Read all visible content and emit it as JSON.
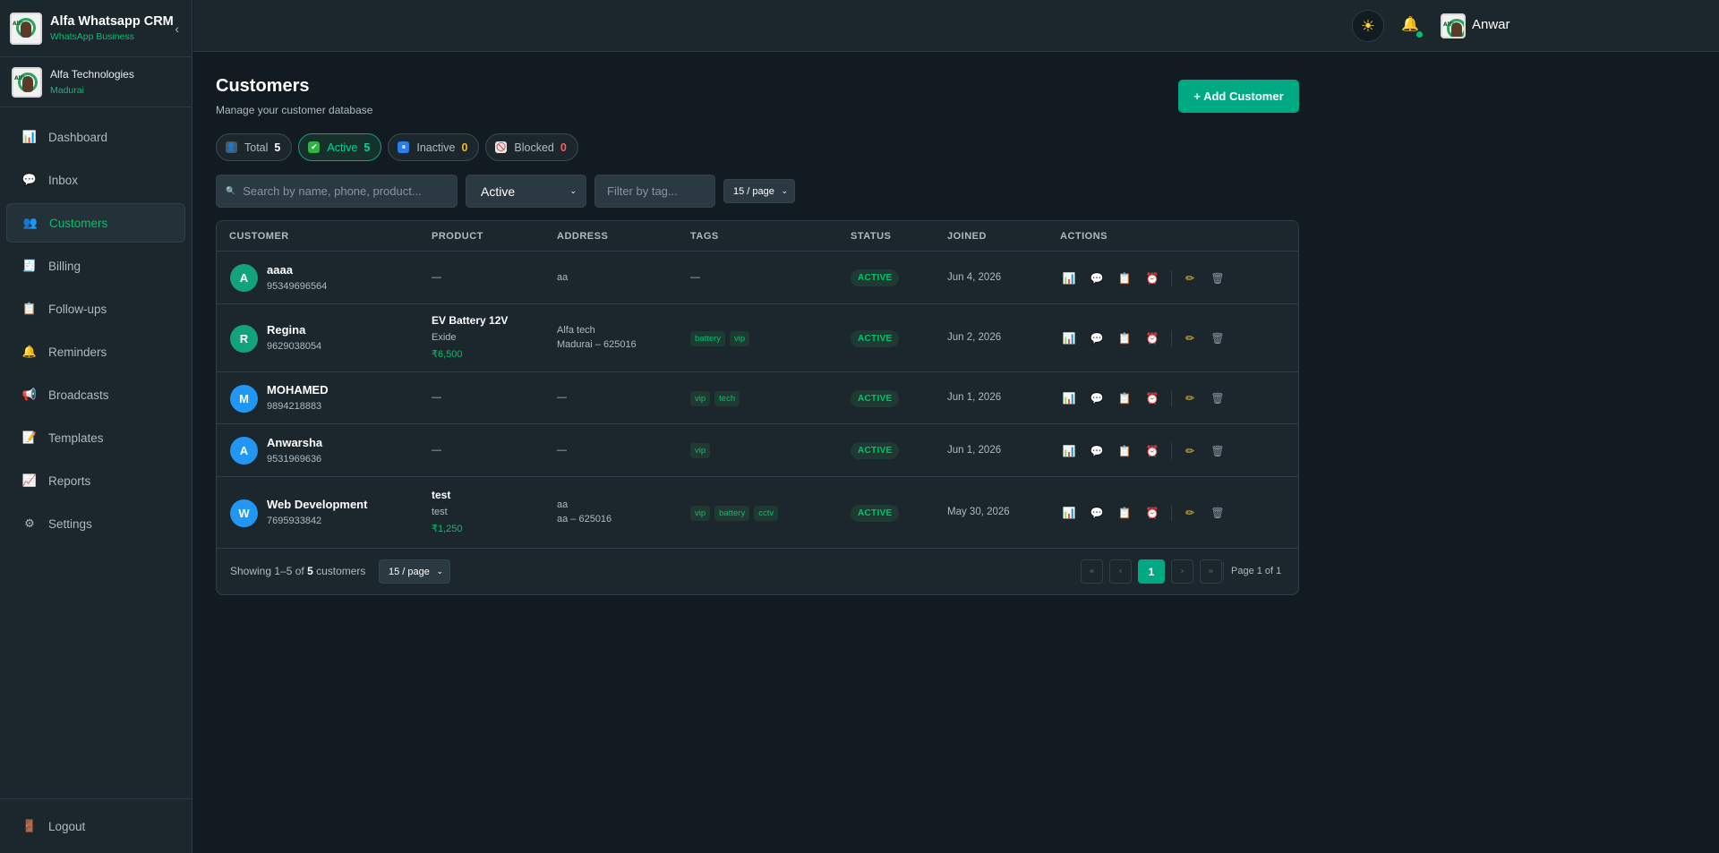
{
  "app": {
    "title": "Alfa Whatsapp CRM",
    "subtitle": "WhatsApp Business",
    "collapse_icon": "chevron-left-icon",
    "collapse_glyph": "‹"
  },
  "org": {
    "name": "Alfa Technologies",
    "location": "Madurai"
  },
  "sidebar": {
    "items": [
      {
        "label": "Dashboard",
        "icon": "bar-chart-icon",
        "glyph": "📊",
        "active": false
      },
      {
        "label": "Inbox",
        "icon": "chat-icon",
        "glyph": "💬",
        "active": false
      },
      {
        "label": "Customers",
        "icon": "users-icon",
        "glyph": "👥",
        "active": true
      },
      {
        "label": "Billing",
        "icon": "receipt-icon",
        "glyph": "🧾",
        "active": false
      },
      {
        "label": "Follow-ups",
        "icon": "clipboard-icon",
        "glyph": "📋",
        "active": false
      },
      {
        "label": "Reminders",
        "icon": "bell-icon",
        "glyph": "🔔",
        "active": false
      },
      {
        "label": "Broadcasts",
        "icon": "megaphone-icon",
        "glyph": "📢",
        "active": false
      },
      {
        "label": "Templates",
        "icon": "memo-icon",
        "glyph": "📝",
        "active": false
      },
      {
        "label": "Reports",
        "icon": "trend-chart-icon",
        "glyph": "📈",
        "active": false
      },
      {
        "label": "Settings",
        "icon": "gear-icon",
        "glyph": "⚙",
        "active": false
      }
    ],
    "logout": {
      "label": "Logout",
      "icon": "door-icon",
      "glyph": "🚪"
    }
  },
  "header": {
    "theme_icon": "sun-icon",
    "theme_glyph": "☀",
    "bell_icon": "bell-icon",
    "bell_glyph": "🔔",
    "user_name": "Anwar"
  },
  "page": {
    "title": "Customers",
    "subtitle": "Manage your customer database",
    "add_button": "+ Add Customer"
  },
  "stats": [
    {
      "label": "Total",
      "count": "5",
      "icon": "user-icon",
      "glyph": "👤",
      "count_color": "#ffffff",
      "icon_bg": "#4a5a63"
    },
    {
      "label": "Active",
      "count": "5",
      "icon": "check-icon",
      "glyph": "✔",
      "count_color": "#00d68f",
      "icon_bg": "#2fb344"
    },
    {
      "label": "Inactive",
      "count": "0",
      "icon": "pause-icon",
      "glyph": "⏸",
      "count_color": "#f5b92a",
      "icon_bg": "#2b7de9"
    },
    {
      "label": "Blocked",
      "count": "0",
      "icon": "block-icon",
      "glyph": "🚫",
      "count_color": "#ff5c5c",
      "icon_bg": "#e8e8e8"
    }
  ],
  "filters": {
    "search_placeholder": "Search by name, phone, product...",
    "search_icon": "search-icon",
    "search_glyph": "🔍",
    "status_value": "Active",
    "tag_placeholder": "Filter by tag...",
    "per_page": "15 / page",
    "chevron_glyph": "⌄"
  },
  "table": {
    "headers": [
      "CUSTOMER",
      "PRODUCT",
      "ADDRESS",
      "TAGS",
      "STATUS",
      "JOINED",
      "ACTIONS"
    ],
    "rows": [
      {
        "initial": "A",
        "avatar_color": "#12a37c",
        "name": "aaaa",
        "phone": "95349696564",
        "product_name": "",
        "product_brand": "",
        "product_price": "",
        "product_dash": "—",
        "address1": "aa",
        "address2": "",
        "tags": [],
        "tags_dash": "—",
        "status": "ACTIVE",
        "joined": "Jun 4, 2026"
      },
      {
        "initial": "R",
        "avatar_color": "#12a37c",
        "name": "Regina",
        "phone": "9629038054",
        "product_name": "EV Battery 12V",
        "product_brand": "Exide",
        "product_price": "₹6,500",
        "product_dash": "",
        "address1": "Alfa tech",
        "address2": "Madurai – 625016",
        "tags": [
          "battery",
          "vip"
        ],
        "tags_dash": "",
        "status": "ACTIVE",
        "joined": "Jun 2, 2026"
      },
      {
        "initial": "M",
        "avatar_color": "#2196f3",
        "name": "MOHAMED",
        "phone": "9894218883",
        "product_name": "",
        "product_brand": "",
        "product_price": "",
        "product_dash": "—",
        "address1": "—",
        "address2": "",
        "tags": [
          "vip",
          "tech"
        ],
        "tags_dash": "",
        "status": "ACTIVE",
        "joined": "Jun 1, 2026"
      },
      {
        "initial": "A",
        "avatar_color": "#2196f3",
        "name": "Anwarsha",
        "phone": "9531969636",
        "product_name": "",
        "product_brand": "",
        "product_price": "",
        "product_dash": "—",
        "address1": "—",
        "address2": "",
        "tags": [
          "vip"
        ],
        "tags_dash": "",
        "status": "ACTIVE",
        "joined": "Jun 1, 2026"
      },
      {
        "initial": "W",
        "avatar_color": "#2196f3",
        "name": "Web Development",
        "phone": "7695933842",
        "product_name": "test",
        "product_brand": "test",
        "product_price": "₹1,250",
        "product_dash": "",
        "address1": "aa",
        "address2": "aa – 625016",
        "tags": [
          "vip",
          "battery",
          "cctv"
        ],
        "tags_dash": "",
        "status": "ACTIVE",
        "joined": "May 30, 2026"
      }
    ],
    "actions": [
      {
        "name": "analytics-icon",
        "glyph": "📊"
      },
      {
        "name": "message-icon",
        "glyph": "💬"
      },
      {
        "name": "notes-icon",
        "glyph": "📋"
      },
      {
        "name": "alarm-icon",
        "glyph": "⏰"
      },
      {
        "name": "edit-icon",
        "glyph": "✏"
      },
      {
        "name": "delete-icon",
        "glyph": "🗑"
      }
    ]
  },
  "pagination": {
    "showing_prefix": "Showing 1–5 of ",
    "showing_count": "5",
    "showing_suffix": " customers",
    "per_page": "15 / page",
    "first": "«",
    "prev": "‹",
    "current": "1",
    "next": "›",
    "last": "»",
    "page_of": "Page 1 of 1"
  }
}
